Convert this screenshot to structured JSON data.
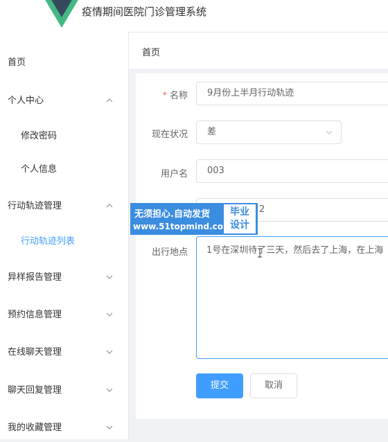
{
  "header": {
    "app_title": "疫情期间医院门诊管理系统",
    "logo_icon": "vue-logo-icon"
  },
  "colors": {
    "primary": "#409eff",
    "required": "#f56c6c",
    "watermark": "#3b8de0",
    "logo_green": "#42b883",
    "logo_dark": "#35495e"
  },
  "sidebar": {
    "items": [
      {
        "label": "首页"
      },
      {
        "label": "个人中心",
        "expanded": true
      },
      {
        "label": "修改密码"
      },
      {
        "label": "个人信息"
      },
      {
        "label": "行动轨迹管理",
        "expanded": true
      },
      {
        "label": "行动轨迹列表",
        "active": true
      },
      {
        "label": "异样报告管理",
        "expanded": false
      },
      {
        "label": "预约信息管理",
        "expanded": false
      },
      {
        "label": "在线聊天管理",
        "expanded": false
      },
      {
        "label": "聊天回复管理",
        "expanded": false
      },
      {
        "label": "我的收藏管理",
        "expanded": false
      }
    ]
  },
  "breadcrumb": {
    "home": "首页"
  },
  "form": {
    "required_mark": "*",
    "name_label": "名称",
    "name_value": "9月份上半月行动轨迹",
    "status_label": "现在状况",
    "status_value": "差",
    "username_label": "用户名",
    "username_value": "003",
    "fourth_value": "2",
    "location_label": "出行地点",
    "location_value": "1号在深圳待了三天，然后去了上海，在上海",
    "submit_label": "提交",
    "cancel_label": "取消"
  },
  "watermark": {
    "line1": "无须担心.自动发货",
    "line2": "www.51topmind.com",
    "box_line1": "毕业",
    "box_line2": "设计"
  }
}
